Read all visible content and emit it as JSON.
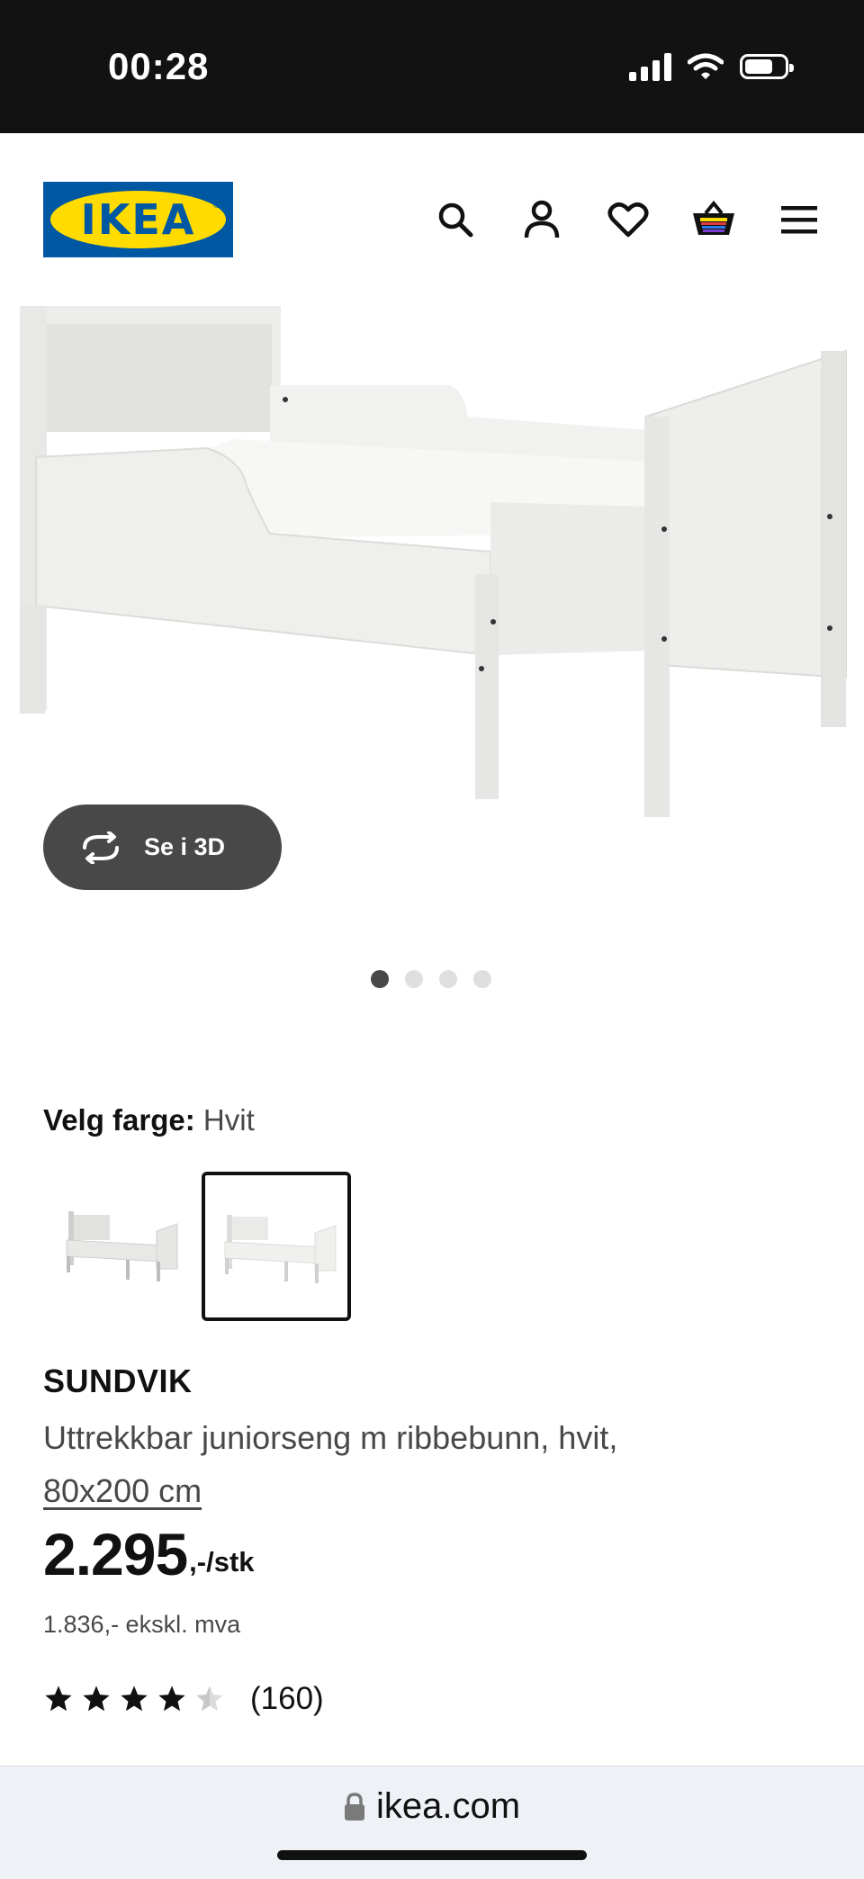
{
  "status_bar": {
    "time": "00:28",
    "icons": [
      "signal-icon",
      "wifi-icon",
      "battery-icon"
    ]
  },
  "header": {
    "logo_text": "IKEA",
    "icons": [
      "search-icon",
      "account-icon",
      "heart-icon",
      "basket-icon",
      "menu-icon"
    ],
    "brand_colors": {
      "blue": "#0058a3",
      "yellow": "#ffdb00"
    }
  },
  "gallery": {
    "view3d_label": "Se i 3D",
    "page_count": 4,
    "active_page": 1
  },
  "color_select": {
    "label": "Velg farge:",
    "value": "Hvit",
    "selected_index": 2,
    "swatch_count": 2
  },
  "product": {
    "name": "SUNDVIK",
    "description": "Uttrekkbar juniorseng m ribbebunn, hvit,",
    "size": "80x200 cm",
    "price_main": "2.295",
    "price_suffix": ",-/stk",
    "price_ex_vat": "1.836,- ekskl. mva",
    "rating": 4.5,
    "review_count": "(160)"
  },
  "browser": {
    "url": "ikea.com"
  }
}
